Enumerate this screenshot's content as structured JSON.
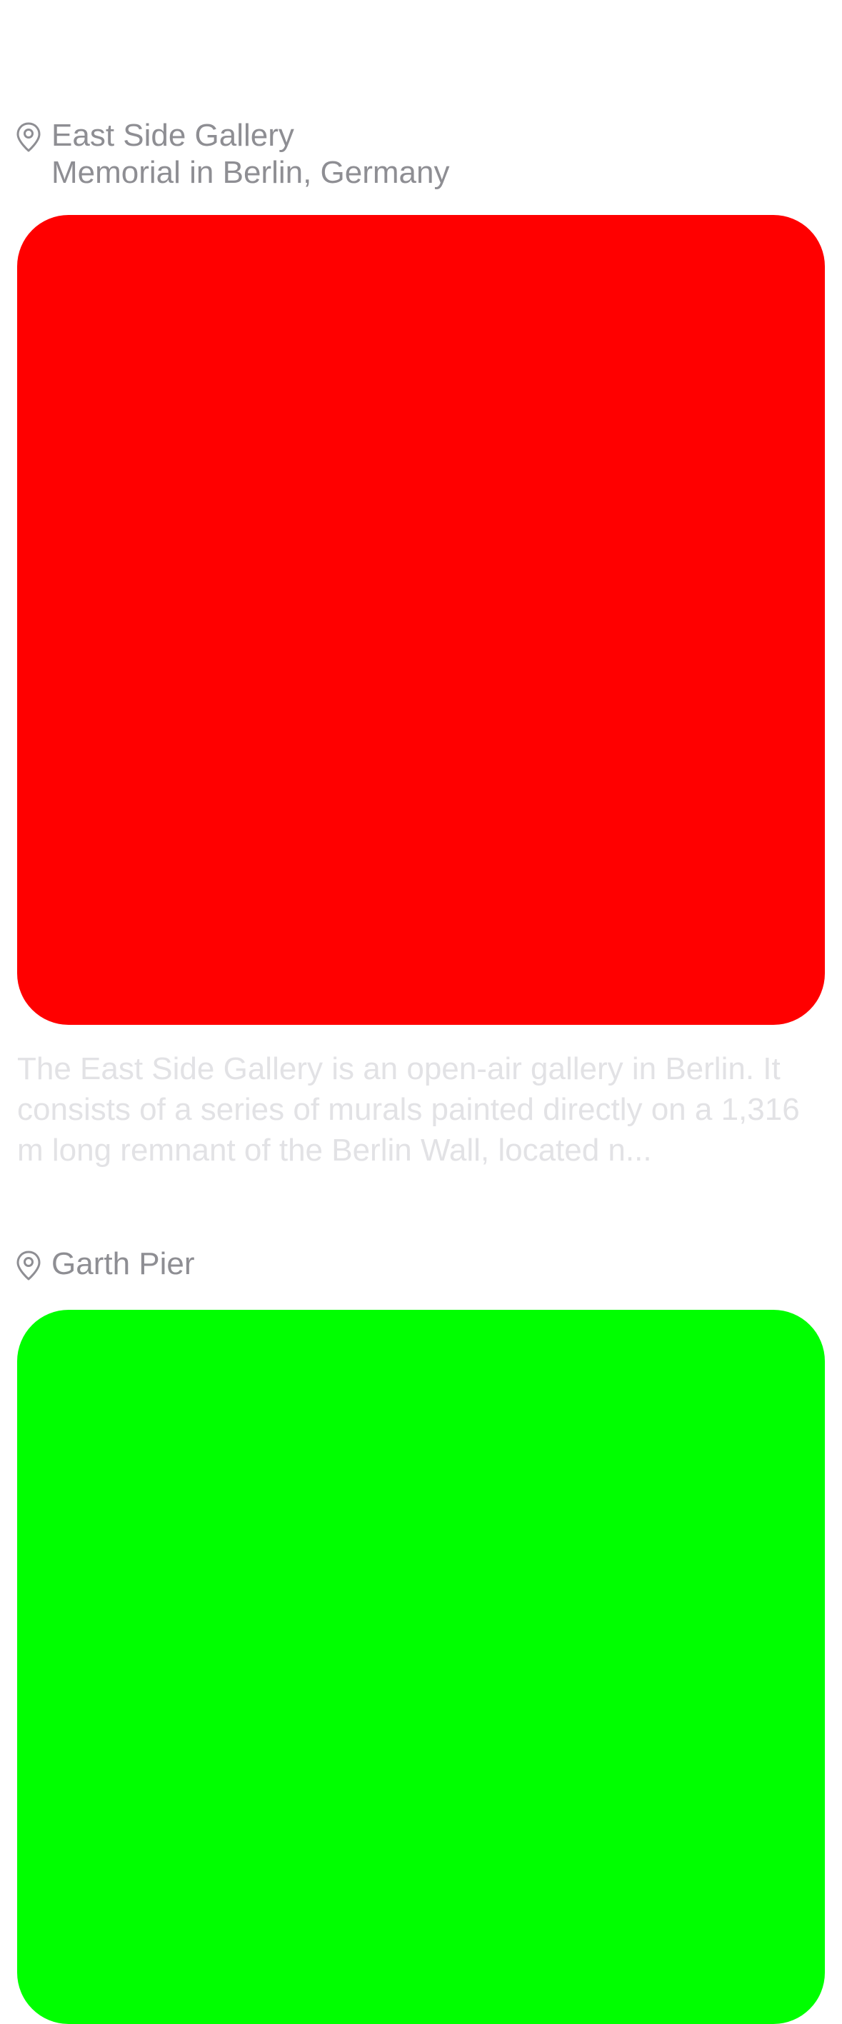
{
  "places": [
    {
      "name": "East Side Gallery",
      "subtitle": "Memorial in Berlin, Germany",
      "image_color": "#ff0000",
      "description": "The East Side Gallery is an open-air gallery in Berlin. It consists of a series of murals painted directly on a 1,316 m long remnant of the Berlin Wall, located n..."
    },
    {
      "name": "Garth Pier",
      "image_color": "#00ff00"
    }
  ],
  "icons": {
    "location": "map-pin-icon"
  }
}
